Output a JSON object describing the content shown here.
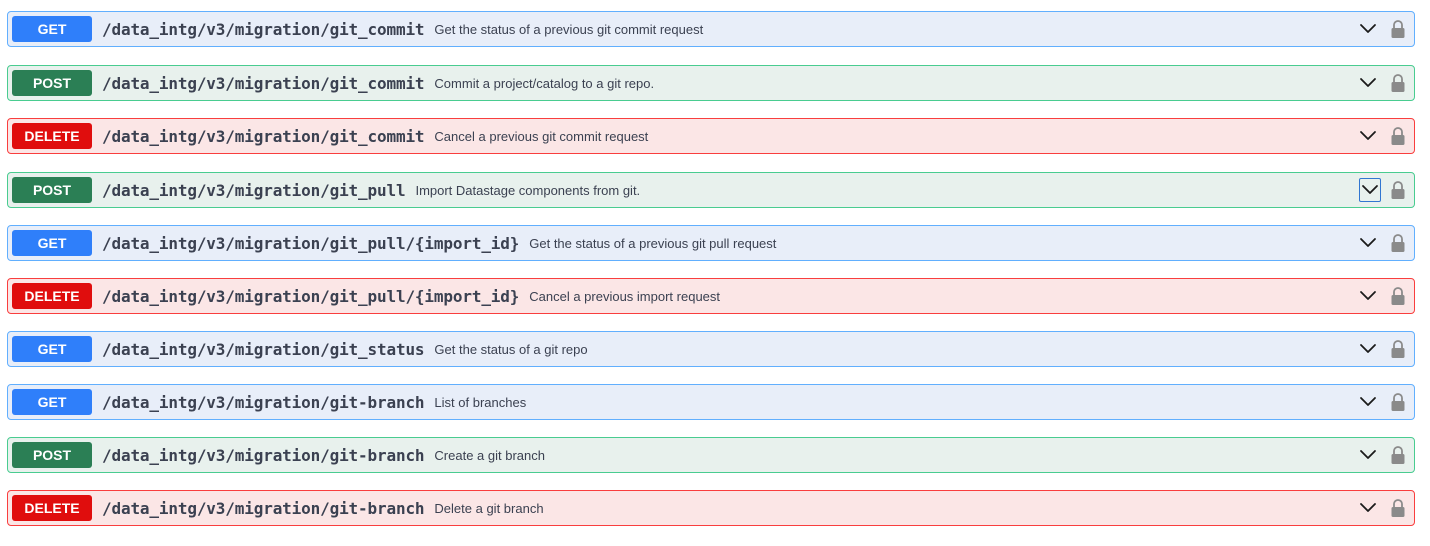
{
  "operations": [
    {
      "method": "GET",
      "type": "get",
      "path": "/data_intg/v3/migration/git_commit",
      "description": "Get the status of a previous git commit request",
      "chevron_icon": "chevron-down-icon",
      "lock_icon": "lock-icon"
    },
    {
      "method": "POST",
      "type": "post",
      "path": "/data_intg/v3/migration/git_commit",
      "description": "Commit a project/catalog to a git repo.",
      "chevron_icon": "chevron-down-icon",
      "lock_icon": "lock-icon"
    },
    {
      "method": "DELETE",
      "type": "delete",
      "path": "/data_intg/v3/migration/git_commit",
      "description": "Cancel a previous git commit request",
      "chevron_icon": "chevron-down-icon",
      "lock_icon": "lock-icon"
    },
    {
      "method": "POST",
      "type": "post",
      "path": "/data_intg/v3/migration/git_pull",
      "description": "Import Datastage components from git.",
      "chevron_icon": "chevron-down-icon",
      "lock_icon": "lock-icon",
      "focused": true
    },
    {
      "method": "GET",
      "type": "get",
      "path": "/data_intg/v3/migration/git_pull/{import_id}",
      "description": "Get the status of a previous git pull request",
      "chevron_icon": "chevron-down-icon",
      "lock_icon": "lock-icon"
    },
    {
      "method": "DELETE",
      "type": "delete",
      "path": "/data_intg/v3/migration/git_pull/{import_id}",
      "description": "Cancel a previous import request",
      "chevron_icon": "chevron-down-icon",
      "lock_icon": "lock-icon"
    },
    {
      "method": "GET",
      "type": "get",
      "path": "/data_intg/v3/migration/git_status",
      "description": "Get the status of a git repo",
      "chevron_icon": "chevron-down-icon",
      "lock_icon": "lock-icon"
    },
    {
      "method": "GET",
      "type": "get",
      "path": "/data_intg/v3/migration/git-branch",
      "description": "List of branches",
      "chevron_icon": "chevron-down-icon",
      "lock_icon": "lock-icon"
    },
    {
      "method": "POST",
      "type": "post",
      "path": "/data_intg/v3/migration/git-branch",
      "description": "Create a git branch",
      "chevron_icon": "chevron-down-icon",
      "lock_icon": "lock-icon"
    },
    {
      "method": "DELETE",
      "type": "delete",
      "path": "/data_intg/v3/migration/git-branch",
      "description": "Delete a git branch",
      "chevron_icon": "chevron-down-icon",
      "lock_icon": "lock-icon"
    }
  ],
  "colors": {
    "get_badge": "#2f7ffa",
    "post_badge": "#2b7f55",
    "delete_badge": "#e00d0d",
    "get_background": "#e8eef9",
    "post_background": "#e8f1ed",
    "delete_background": "#fbe6e6"
  }
}
